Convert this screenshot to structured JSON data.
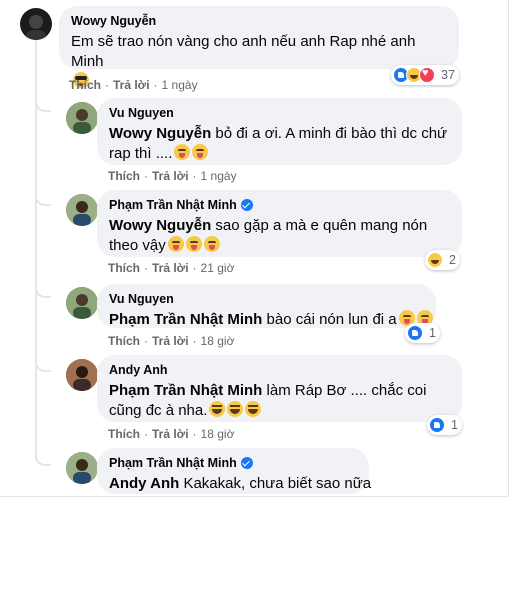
{
  "actions": {
    "like": "Thích",
    "reply": "Trả lời",
    "sep": "·"
  },
  "comments": [
    {
      "author": "Wowy Nguyễn",
      "text": "Em sẽ trao nón vàng cho anh nếu anh Rap nhé anh Minh",
      "time": "1 ngày",
      "reaction_count": "37",
      "avatar_color": "#1c1c1c"
    },
    {
      "author": "Vu Nguyen",
      "mention": "Wowy Nguyễn",
      "text": " bỏ đi a ơi. A minh đi bào thì dc chứ rap thì ....",
      "time": "1 ngày",
      "avatar_color": "#6b8a5a"
    },
    {
      "author": "Phạm Trần Nhật Minh",
      "mention": "Wowy Nguyễn",
      "text": " sao gặp a mà e quên mang nón theo vậy",
      "time": "21 giờ",
      "reaction_count": "2",
      "avatar_color": "#7a8f6a"
    },
    {
      "author": "Vu Nguyen",
      "mention": "Phạm Trần Nhật Minh",
      "text": " bào cái nón lun đi a",
      "time": "18 giờ",
      "reaction_count": "1",
      "avatar_color": "#6b8a5a"
    },
    {
      "author": "Andy Anh",
      "mention": "Phạm Trần Nhật Minh",
      "text": " làm Ráp Bơ .... chắc coi cũng đc à nha.",
      "time": "18 giờ",
      "reaction_count": "1",
      "avatar_color": "#8a5a3a"
    },
    {
      "author": "Phạm Trần Nhật Minh",
      "mention": "Andy Anh",
      "text": " Kakakak, chưa biết sao nữa",
      "avatar_color": "#7a8f6a"
    }
  ],
  "colors": {
    "bubble": "#f0f2f5",
    "like_blue": "#1877f2",
    "love_red": "#f33e58",
    "haha_yellow": "#f7c94a",
    "meta_grey": "#65676b"
  },
  "icons": [
    "verified-badge-icon",
    "like-reaction-icon",
    "haha-reaction-icon",
    "love-reaction-icon",
    "tongue-emoji-icon",
    "laugh-emoji-icon",
    "sunglasses-emoji-icon"
  ]
}
